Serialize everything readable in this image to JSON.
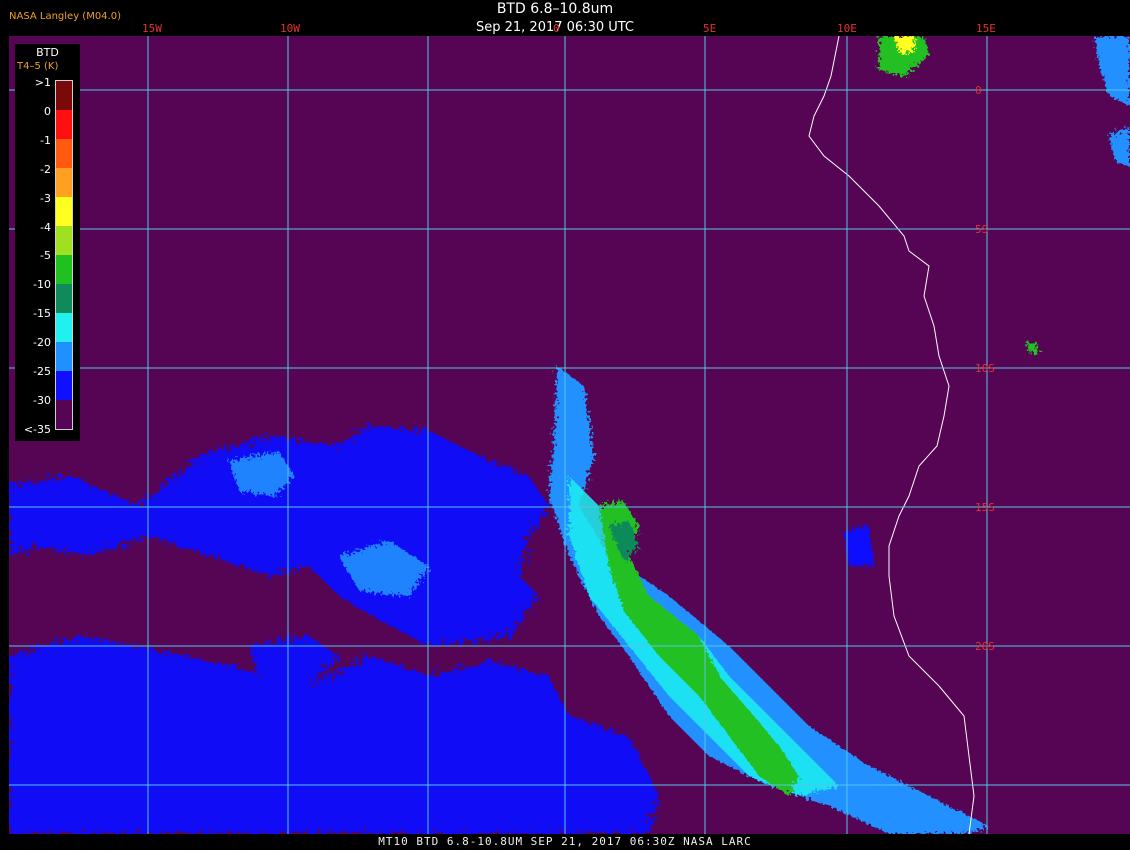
{
  "header": {
    "agency": "NASA Langley (M04.0)",
    "title": "BTD 6.8–10.8um",
    "datetime": "Sep 21, 2017 06:30 UTC"
  },
  "footer": {
    "caption": "MT10  BTD 6.8-10.8UM  SEP 21, 2017 06:30Z  NASA LARC"
  },
  "legend": {
    "title": "BTD",
    "subtitle": "T4–5 (K)",
    "labels": [
      ">1",
      "0",
      "-1",
      "-2",
      "-3",
      "-4",
      "-5",
      "-10",
      "-15",
      "-20",
      "-25",
      "-30",
      "<-35"
    ],
    "colors": [
      "#7a0a0a",
      "#ff1010",
      "#ff5a10",
      "#ffa020",
      "#ffff20",
      "#a0e020",
      "#20c020",
      "#108a5a",
      "#20f0f0",
      "#2090ff",
      "#1010ff",
      "#560454"
    ]
  },
  "map": {
    "background_color": "#560454",
    "grid_color": "#50c8e8",
    "longitude_labels": [
      "15W",
      "10W",
      "0",
      "5E",
      "10E",
      "15E"
    ],
    "latitude_labels": [
      "0",
      "5S",
      "10S",
      "15S",
      "20S"
    ],
    "coastline_color": "#ffffff"
  }
}
